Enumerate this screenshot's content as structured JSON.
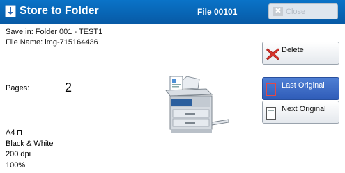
{
  "titlebar": {
    "title": "Store to Folder",
    "file_label": "File 00101",
    "close_label": "Close",
    "close_icon": "x-icon"
  },
  "info": {
    "save_in": "Save in: Folder 001 - TEST1",
    "file_name": "File Name: img-715164436",
    "pages_label": "Pages:",
    "pages_value": "2",
    "paper_size": "A4",
    "color_mode": "Black & White",
    "resolution": "200 dpi",
    "scale": "100%"
  },
  "buttons": {
    "delete": "Delete",
    "last_original": "Last Original",
    "next_original": "Next Original"
  },
  "colors": {
    "titlebar": "#0a73c8",
    "selected_button": "#3a68c4",
    "delete_icon": "#d9332b"
  }
}
